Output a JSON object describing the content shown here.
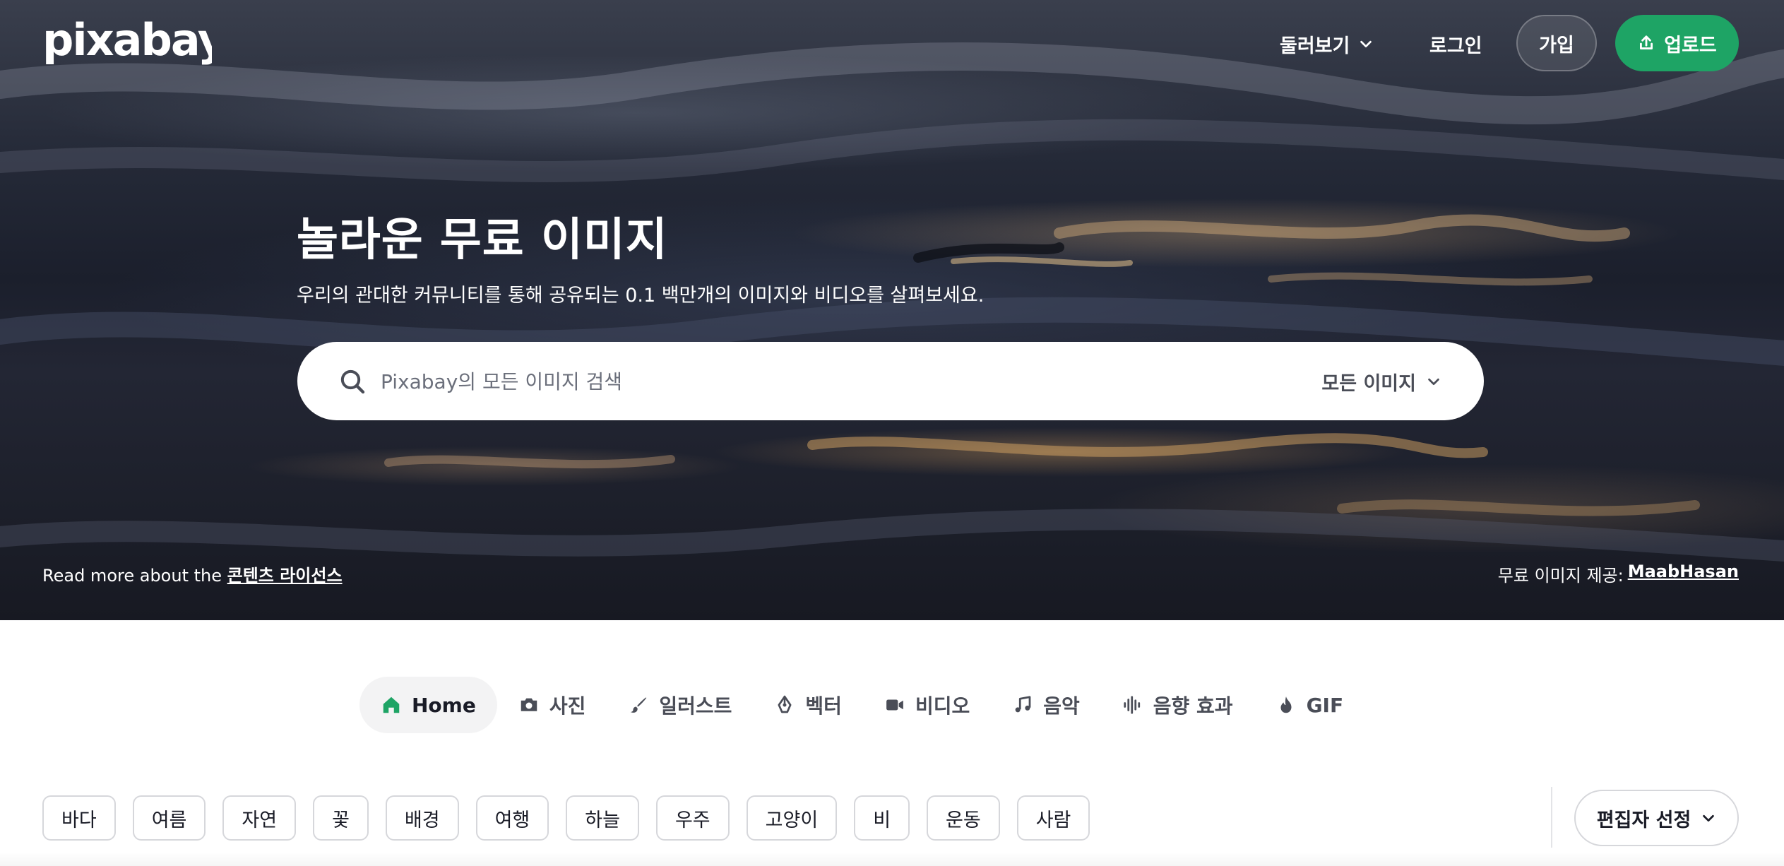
{
  "header": {
    "logo_text": "pixabay",
    "explore_label": "둘러보기",
    "login_label": "로그인",
    "join_label": "가입",
    "upload_label": "업로드"
  },
  "hero": {
    "title": "놀라운 무료 이미지",
    "subtitle": "우리의 관대한 커뮤니티를 통해 공유되는 0.1 백만개의 이미지와 비디오를 살펴보세요.",
    "search": {
      "placeholder": "Pixabay의 모든 이미지 검색",
      "value": "",
      "filter_label": "모든 이미지"
    },
    "license_prefix": "Read more about the ",
    "license_link": "콘텐츠 라이선스",
    "credit_prefix": "무료 이미지 제공:",
    "credit_author": "MaabHasan"
  },
  "tabs": [
    {
      "label": "Home",
      "icon": "home-icon",
      "active": true
    },
    {
      "label": "사진",
      "icon": "camera-icon",
      "active": false
    },
    {
      "label": "일러스트",
      "icon": "brush-icon",
      "active": false
    },
    {
      "label": "벡터",
      "icon": "pen-nib-icon",
      "active": false
    },
    {
      "label": "비디오",
      "icon": "video-camera-icon",
      "active": false
    },
    {
      "label": "음악",
      "icon": "music-note-icon",
      "active": false
    },
    {
      "label": "음향 효과",
      "icon": "sound-wave-icon",
      "active": false
    },
    {
      "label": "GIF",
      "icon": "flame-icon",
      "active": false
    }
  ],
  "chips": [
    "바다",
    "여름",
    "자연",
    "꽃",
    "배경",
    "여행",
    "하늘",
    "우주",
    "고양이",
    "비",
    "운동",
    "사람"
  ],
  "sort": {
    "label": "편집자 선정"
  },
  "colors": {
    "accent": "#1ea465",
    "tab_active_bg": "#f3f3f4",
    "text_muted": "#4a4d57",
    "chip_border": "#d6d7db"
  }
}
